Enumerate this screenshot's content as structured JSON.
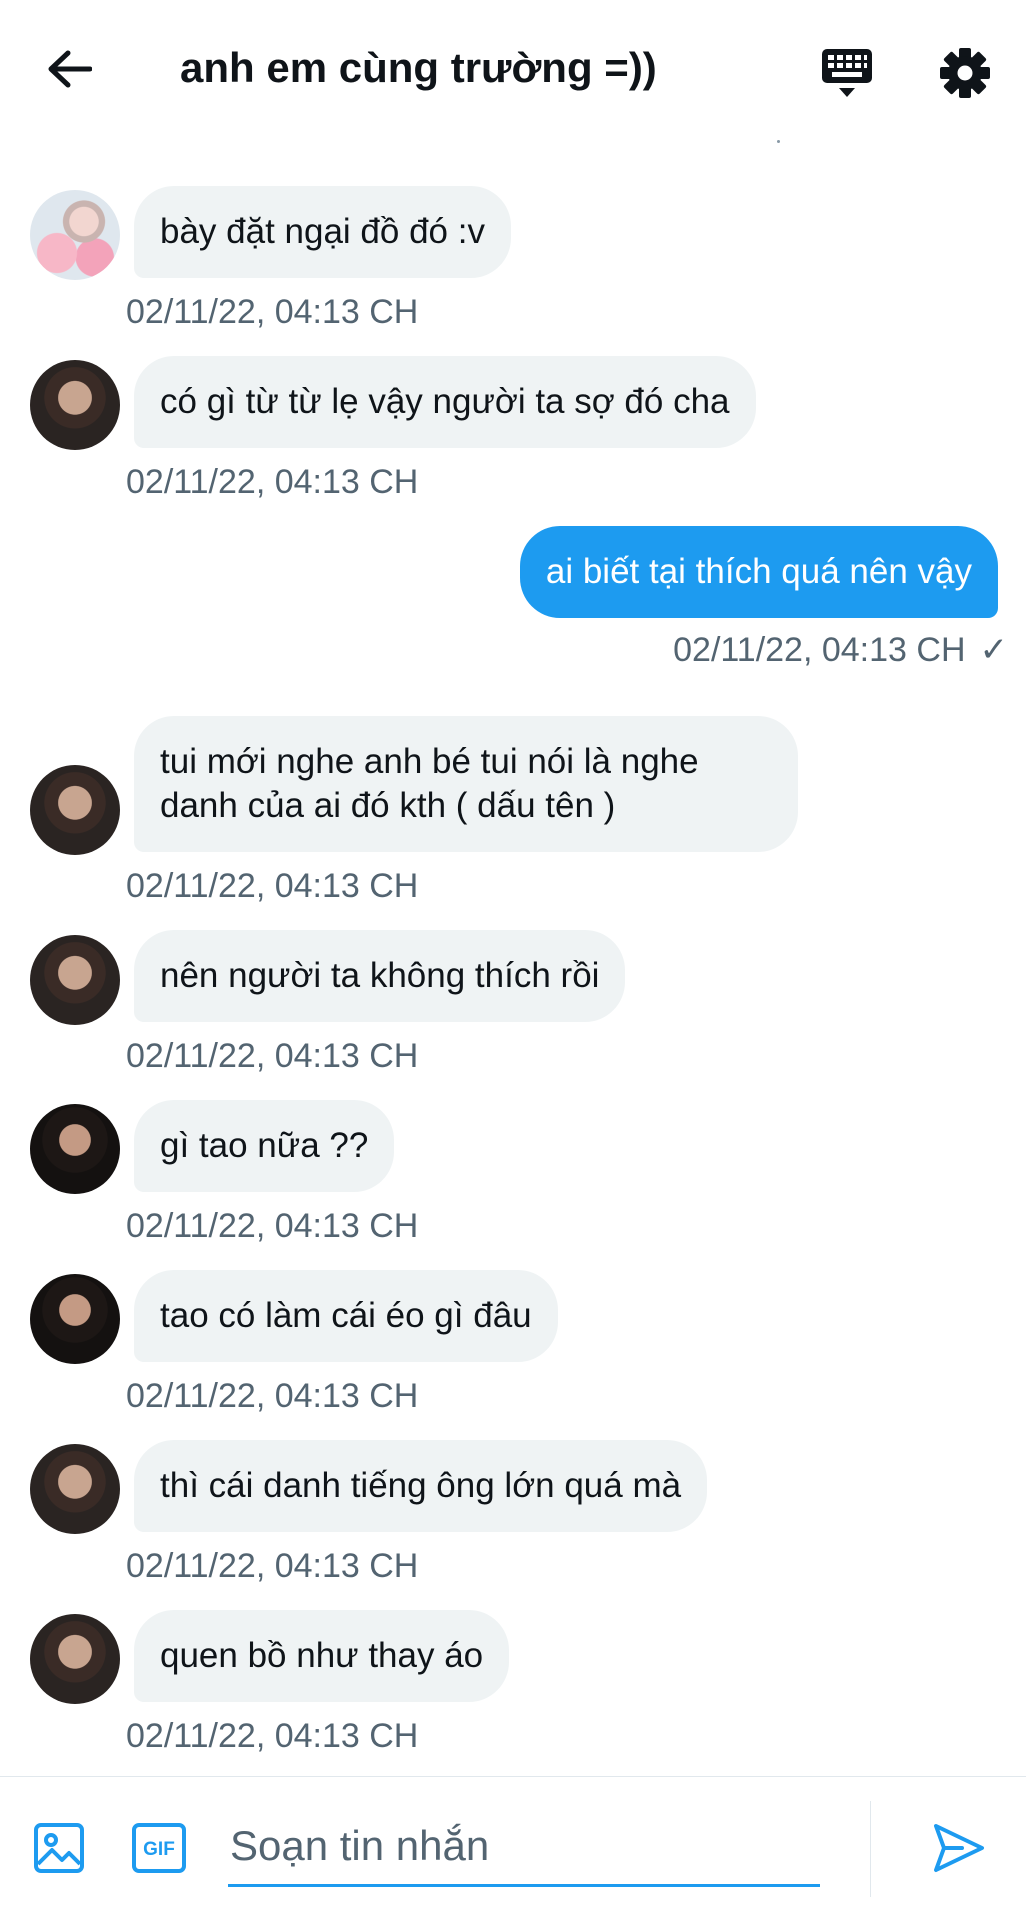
{
  "header": {
    "title": "anh em cùng trường =))",
    "back_icon": "arrow-left-icon",
    "keyboard_icon": "keyboard-icon",
    "settings_icon": "gear-icon"
  },
  "messages": [
    {
      "sender": "other",
      "avatar": "flower-avatar",
      "text": "bày đặt ngại đồ đó :v",
      "time": "02/11/22, 04:13 CH"
    },
    {
      "sender": "other",
      "avatar": "avatar-a",
      "text": "có gì từ từ lẹ vậy người ta sợ đó cha",
      "time": "02/11/22, 04:13 CH"
    },
    {
      "sender": "me",
      "text": "ai biết tại thích quá nên vậy",
      "time": "02/11/22, 04:13 CH",
      "status": "✓"
    },
    {
      "sender": "other",
      "avatar": "avatar-a",
      "text": "tui mới nghe anh bé tui nói là nghe danh của ai đó kth ( dấu tên )",
      "time": "02/11/22, 04:13 CH"
    },
    {
      "sender": "other",
      "avatar": "avatar-a",
      "text": "nên người ta không thích rồi",
      "time": "02/11/22, 04:13 CH"
    },
    {
      "sender": "other",
      "avatar": "avatar-b",
      "text": "gì tao nữa ??",
      "time": "02/11/22, 04:13 CH"
    },
    {
      "sender": "other",
      "avatar": "avatar-b",
      "text": "tao có làm cái éo gì đâu",
      "time": "02/11/22, 04:13 CH"
    },
    {
      "sender": "other",
      "avatar": "avatar-a",
      "text": "thì cái danh tiếng ông lớn quá mà",
      "time": "02/11/22, 04:13 CH"
    },
    {
      "sender": "other",
      "avatar": "avatar-a",
      "text": "quen bồ như thay áo",
      "time": "02/11/22, 04:13 CH"
    }
  ],
  "composer": {
    "placeholder": "Soạn tin nhắn",
    "value": "",
    "image_icon": "image-icon",
    "gif_label": "GIF",
    "send_icon": "send-icon"
  },
  "colors": {
    "accent": "#1d9bf0",
    "bubble_other": "#eff3f4",
    "time_text": "#536471"
  }
}
